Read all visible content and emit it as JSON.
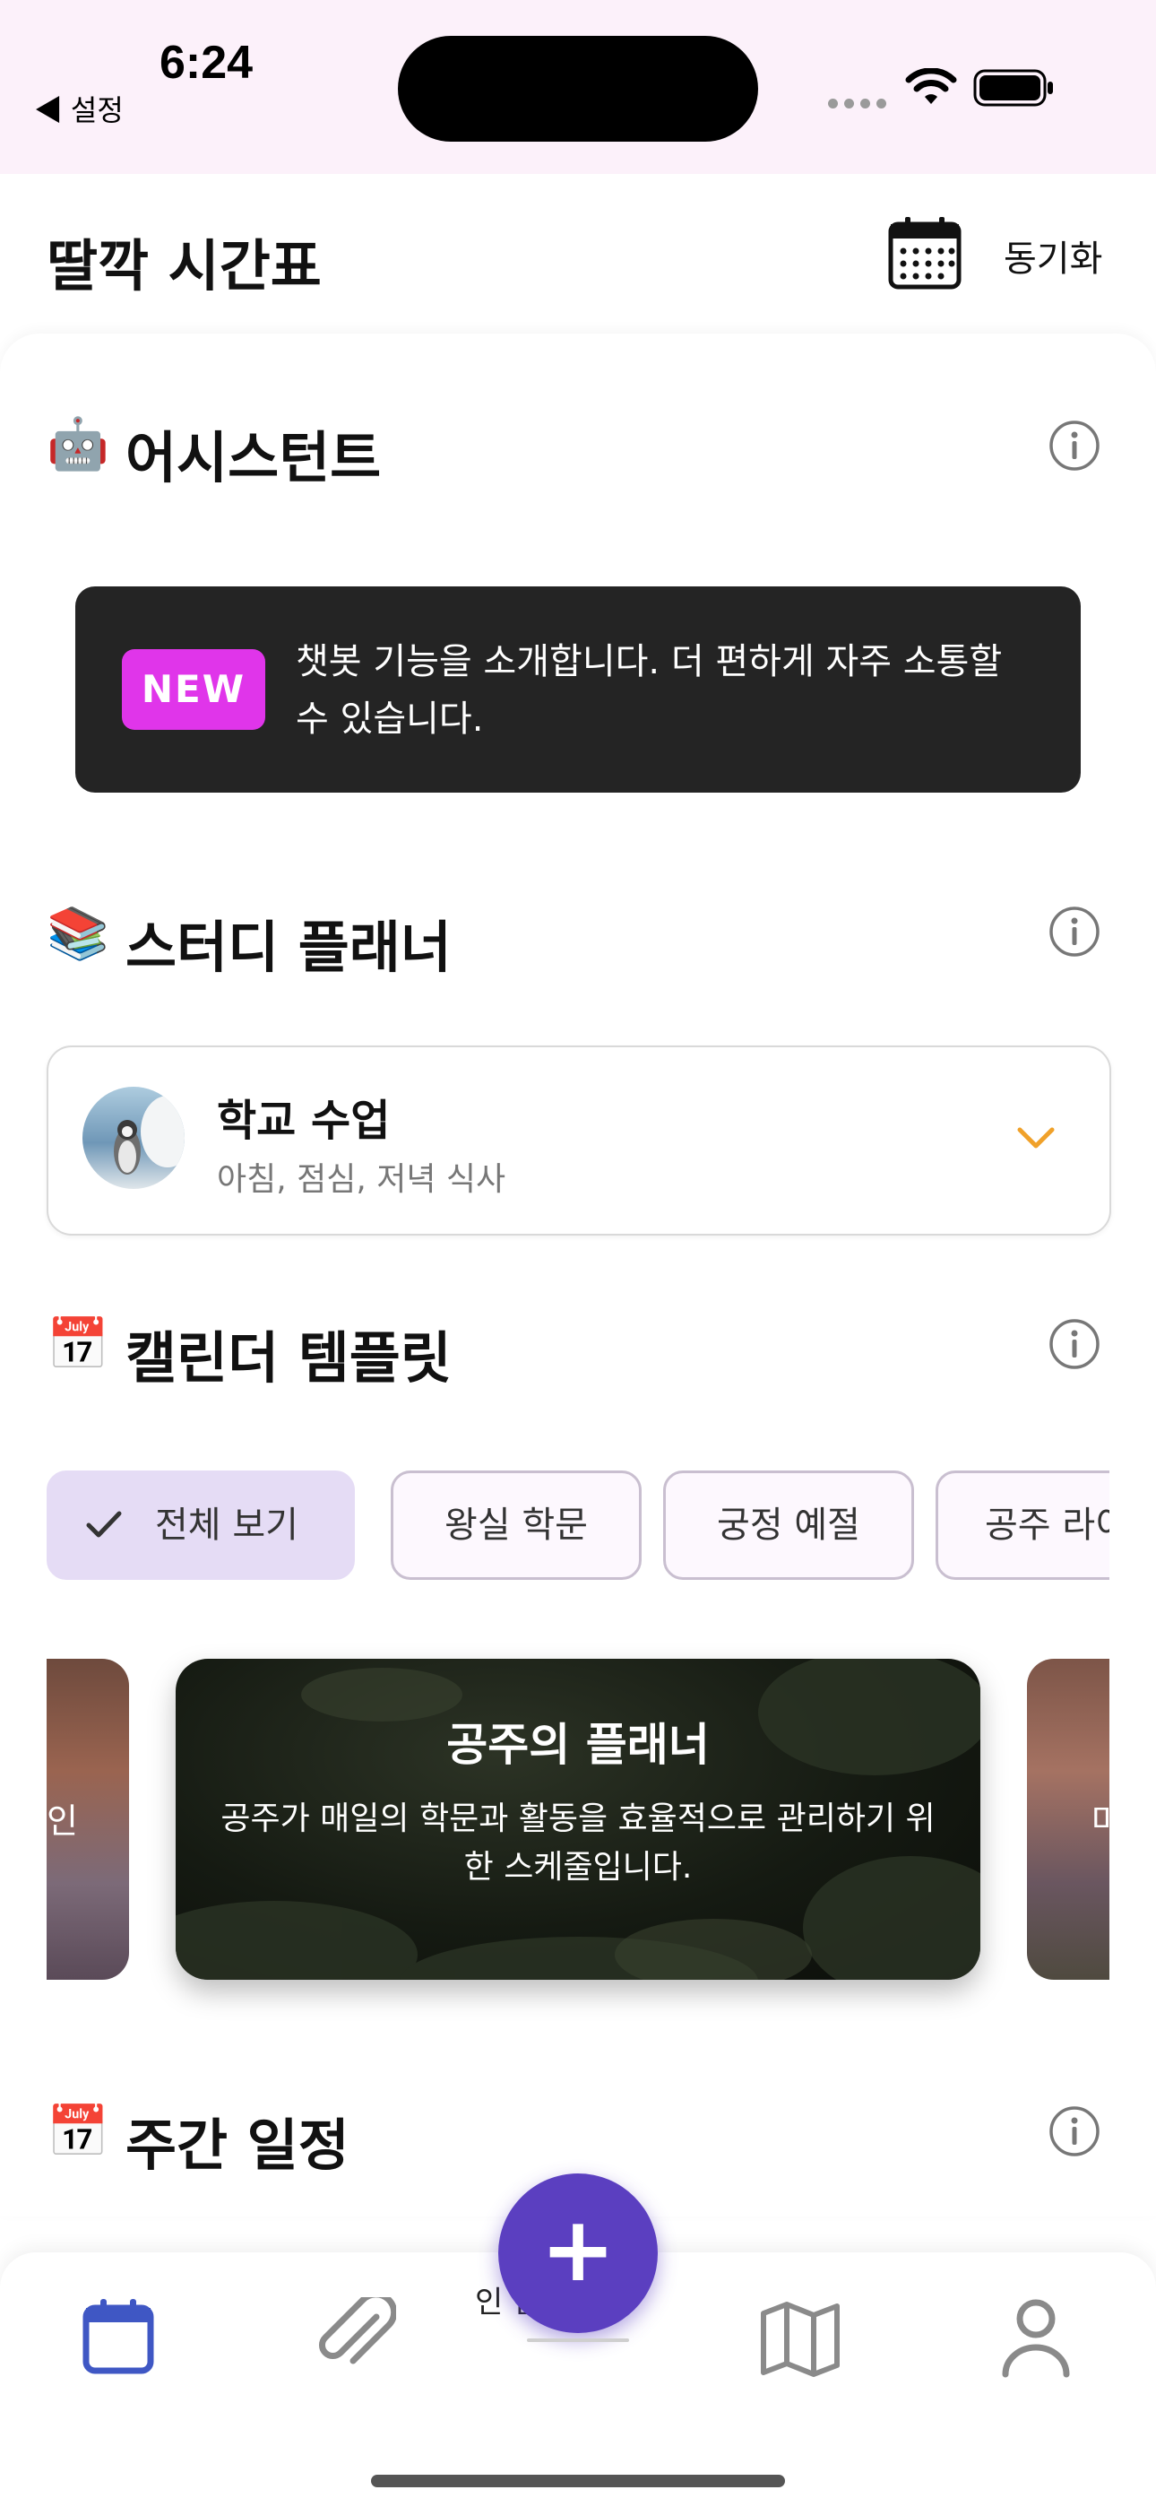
{
  "status_bar": {
    "time": "6:24",
    "back_label": "◀ 설정"
  },
  "app_bar": {
    "title": "딸깍 시간표",
    "calendar_icon": "calendar-icon",
    "sync_label": "동기화"
  },
  "sections": {
    "assistant": {
      "emoji": "🤖",
      "title": "어시스턴트"
    },
    "study_planner": {
      "emoji": "📚",
      "title": "스터디 플래너"
    },
    "calendar_template": {
      "emoji": "📅",
      "title": "캘린더 템플릿"
    },
    "weekly_schedule": {
      "emoji": "📅",
      "title": "주간 일정"
    }
  },
  "banner": {
    "badge": "NEW",
    "text": "챗봇 기능을 소개합니다. 더 편하게 자주 소통할 수 있습니다."
  },
  "planner_selector": {
    "title": "학교 수업",
    "subtitle": "아침, 점심, 저녁 식사"
  },
  "filter_chips": [
    {
      "label": "전체 보기",
      "selected": true
    },
    {
      "label": "왕실 학문",
      "selected": false
    },
    {
      "label": "궁정 예절",
      "selected": false
    },
    {
      "label": "공주 라이",
      "selected": false
    }
  ],
  "templates": {
    "left_partial_text": "인",
    "right_partial_text": "마",
    "main": {
      "title": "공주의 플래너",
      "description": "공주가 매일의 학문과 활동을 효율적으로 관리하기 위한 스케줄입니다."
    }
  },
  "bottom_nav": {
    "items": [
      "calendar-icon",
      "paperclip-icon",
      "plus-icon",
      "map-icon",
      "profile-icon"
    ],
    "active_color": "#3f57c4",
    "inactive_color": "#8a8a8a",
    "fab_color": "#5b3fc0",
    "peek_text": "인     반"
  }
}
